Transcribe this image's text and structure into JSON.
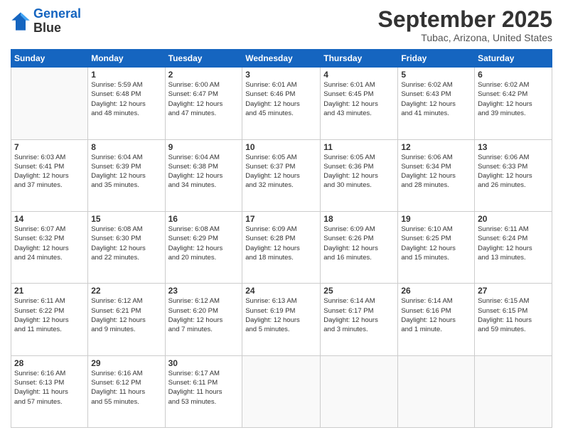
{
  "header": {
    "logo_line1": "General",
    "logo_line2": "Blue",
    "main_title": "September 2025",
    "subtitle": "Tubac, Arizona, United States"
  },
  "weekdays": [
    "Sunday",
    "Monday",
    "Tuesday",
    "Wednesday",
    "Thursday",
    "Friday",
    "Saturday"
  ],
  "weeks": [
    [
      {
        "day": "",
        "info": ""
      },
      {
        "day": "1",
        "info": "Sunrise: 5:59 AM\nSunset: 6:48 PM\nDaylight: 12 hours\nand 48 minutes."
      },
      {
        "day": "2",
        "info": "Sunrise: 6:00 AM\nSunset: 6:47 PM\nDaylight: 12 hours\nand 47 minutes."
      },
      {
        "day": "3",
        "info": "Sunrise: 6:01 AM\nSunset: 6:46 PM\nDaylight: 12 hours\nand 45 minutes."
      },
      {
        "day": "4",
        "info": "Sunrise: 6:01 AM\nSunset: 6:45 PM\nDaylight: 12 hours\nand 43 minutes."
      },
      {
        "day": "5",
        "info": "Sunrise: 6:02 AM\nSunset: 6:43 PM\nDaylight: 12 hours\nand 41 minutes."
      },
      {
        "day": "6",
        "info": "Sunrise: 6:02 AM\nSunset: 6:42 PM\nDaylight: 12 hours\nand 39 minutes."
      }
    ],
    [
      {
        "day": "7",
        "info": "Sunrise: 6:03 AM\nSunset: 6:41 PM\nDaylight: 12 hours\nand 37 minutes."
      },
      {
        "day": "8",
        "info": "Sunrise: 6:04 AM\nSunset: 6:39 PM\nDaylight: 12 hours\nand 35 minutes."
      },
      {
        "day": "9",
        "info": "Sunrise: 6:04 AM\nSunset: 6:38 PM\nDaylight: 12 hours\nand 34 minutes."
      },
      {
        "day": "10",
        "info": "Sunrise: 6:05 AM\nSunset: 6:37 PM\nDaylight: 12 hours\nand 32 minutes."
      },
      {
        "day": "11",
        "info": "Sunrise: 6:05 AM\nSunset: 6:36 PM\nDaylight: 12 hours\nand 30 minutes."
      },
      {
        "day": "12",
        "info": "Sunrise: 6:06 AM\nSunset: 6:34 PM\nDaylight: 12 hours\nand 28 minutes."
      },
      {
        "day": "13",
        "info": "Sunrise: 6:06 AM\nSunset: 6:33 PM\nDaylight: 12 hours\nand 26 minutes."
      }
    ],
    [
      {
        "day": "14",
        "info": "Sunrise: 6:07 AM\nSunset: 6:32 PM\nDaylight: 12 hours\nand 24 minutes."
      },
      {
        "day": "15",
        "info": "Sunrise: 6:08 AM\nSunset: 6:30 PM\nDaylight: 12 hours\nand 22 minutes."
      },
      {
        "day": "16",
        "info": "Sunrise: 6:08 AM\nSunset: 6:29 PM\nDaylight: 12 hours\nand 20 minutes."
      },
      {
        "day": "17",
        "info": "Sunrise: 6:09 AM\nSunset: 6:28 PM\nDaylight: 12 hours\nand 18 minutes."
      },
      {
        "day": "18",
        "info": "Sunrise: 6:09 AM\nSunset: 6:26 PM\nDaylight: 12 hours\nand 16 minutes."
      },
      {
        "day": "19",
        "info": "Sunrise: 6:10 AM\nSunset: 6:25 PM\nDaylight: 12 hours\nand 15 minutes."
      },
      {
        "day": "20",
        "info": "Sunrise: 6:11 AM\nSunset: 6:24 PM\nDaylight: 12 hours\nand 13 minutes."
      }
    ],
    [
      {
        "day": "21",
        "info": "Sunrise: 6:11 AM\nSunset: 6:22 PM\nDaylight: 12 hours\nand 11 minutes."
      },
      {
        "day": "22",
        "info": "Sunrise: 6:12 AM\nSunset: 6:21 PM\nDaylight: 12 hours\nand 9 minutes."
      },
      {
        "day": "23",
        "info": "Sunrise: 6:12 AM\nSunset: 6:20 PM\nDaylight: 12 hours\nand 7 minutes."
      },
      {
        "day": "24",
        "info": "Sunrise: 6:13 AM\nSunset: 6:19 PM\nDaylight: 12 hours\nand 5 minutes."
      },
      {
        "day": "25",
        "info": "Sunrise: 6:14 AM\nSunset: 6:17 PM\nDaylight: 12 hours\nand 3 minutes."
      },
      {
        "day": "26",
        "info": "Sunrise: 6:14 AM\nSunset: 6:16 PM\nDaylight: 12 hours\nand 1 minute."
      },
      {
        "day": "27",
        "info": "Sunrise: 6:15 AM\nSunset: 6:15 PM\nDaylight: 11 hours\nand 59 minutes."
      }
    ],
    [
      {
        "day": "28",
        "info": "Sunrise: 6:16 AM\nSunset: 6:13 PM\nDaylight: 11 hours\nand 57 minutes."
      },
      {
        "day": "29",
        "info": "Sunrise: 6:16 AM\nSunset: 6:12 PM\nDaylight: 11 hours\nand 55 minutes."
      },
      {
        "day": "30",
        "info": "Sunrise: 6:17 AM\nSunset: 6:11 PM\nDaylight: 11 hours\nand 53 minutes."
      },
      {
        "day": "",
        "info": ""
      },
      {
        "day": "",
        "info": ""
      },
      {
        "day": "",
        "info": ""
      },
      {
        "day": "",
        "info": ""
      }
    ]
  ]
}
